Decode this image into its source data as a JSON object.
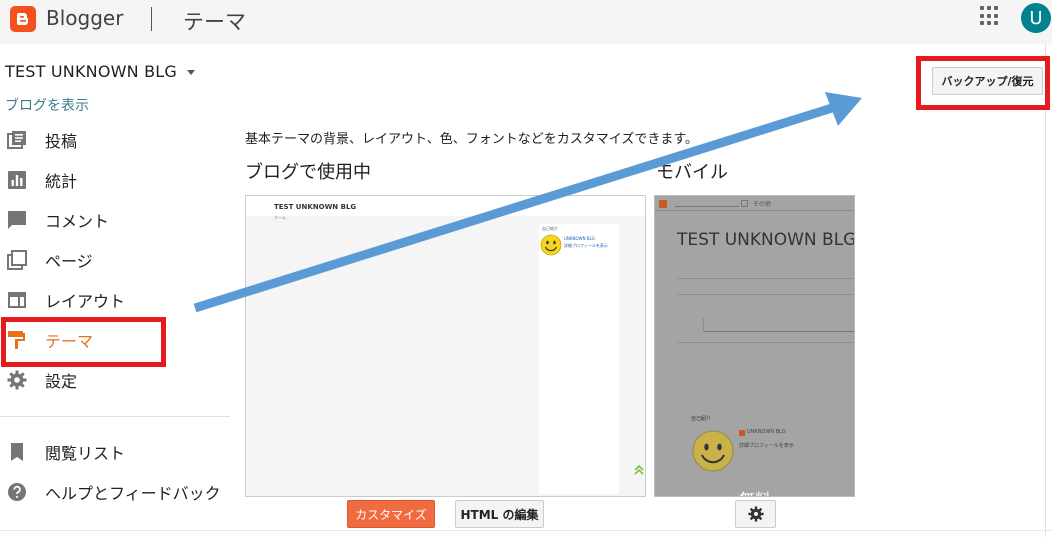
{
  "header": {
    "brand": "Blogger",
    "title": "テーマ",
    "avatar_initial": "U"
  },
  "blog": {
    "name": "TEST UNKNOWN BLG",
    "view_link": "ブログを表示"
  },
  "sidebar": {
    "items": [
      {
        "label": "投稿",
        "icon": "posts-icon"
      },
      {
        "label": "統計",
        "icon": "stats-icon"
      },
      {
        "label": "コメント",
        "icon": "comment-icon"
      },
      {
        "label": "ページ",
        "icon": "pages-icon"
      },
      {
        "label": "レイアウト",
        "icon": "layout-icon"
      },
      {
        "label": "テーマ",
        "icon": "theme-icon",
        "active": true
      },
      {
        "label": "設定",
        "icon": "settings-icon"
      }
    ],
    "secondary": [
      {
        "label": "閲覧リスト",
        "icon": "bookmark-icon"
      },
      {
        "label": "ヘルプとフィードバック",
        "icon": "help-icon"
      }
    ]
  },
  "main": {
    "description": "基本テーマの背景、レイアウト、色、フォントなどをカスタマイズできます。",
    "in_use_title": "ブログで使用中",
    "mobile_title": "モバイル",
    "customize_button": "カスタマイズ",
    "html_button": "HTML の編集",
    "backup_button": "バックアップ/復元"
  },
  "preview": {
    "blog_title": "TEST UNKNOWN BLG",
    "home_link": "ホーム",
    "profile_heading": "自己紹介",
    "profile_name": "UNKNOWN BLG",
    "profile_link": "詳細プロフィールを表示",
    "mobile_title": "TEST UNKNOWN BLG",
    "mobile_menu": "その他",
    "mobile_profile_heading": "自己紹介",
    "mobile_profile_name": "UNKNOWN BLG",
    "mobile_profile_link": "詳細プロフィールを表示",
    "mobile_footer": "無料"
  },
  "colors": {
    "accent": "#e8711a",
    "highlight": "#e6191c",
    "arrow": "#5b9bd5"
  }
}
